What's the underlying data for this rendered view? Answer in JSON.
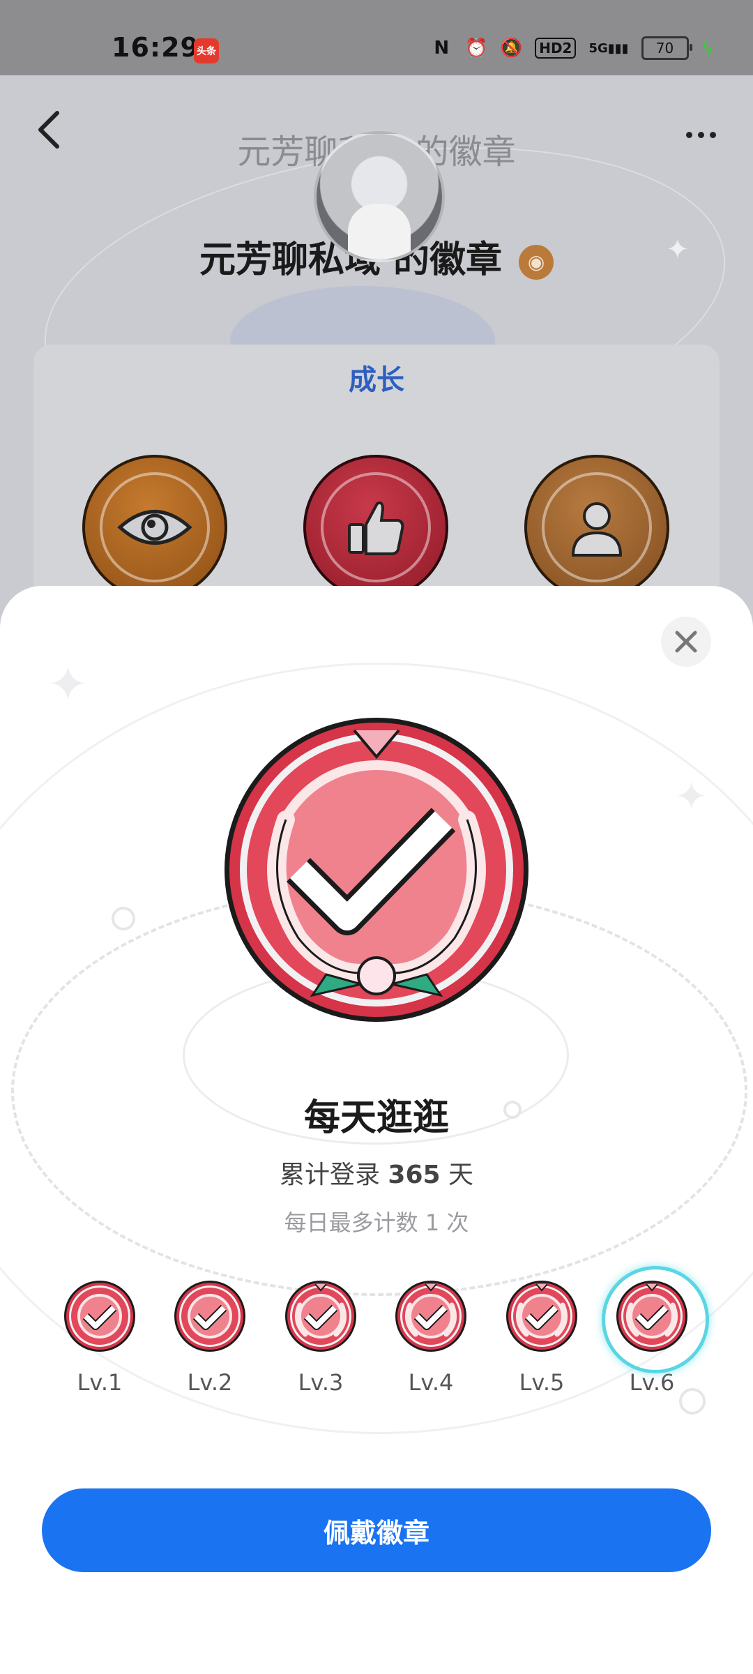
{
  "status_bar": {
    "time": "16:29",
    "app_badge": "头条",
    "network_label": "5G",
    "hd_label": "HD2",
    "battery": "70"
  },
  "nav": {
    "title": "元芳聊私域 的徽章",
    "back_icon": "chevron-left-icon",
    "more_icon": "more-horizontal-icon"
  },
  "profile": {
    "heading": "元芳聊私域 的徽章"
  },
  "growth_section": {
    "title": "成长",
    "badges": [
      "eye-badge",
      "thumbs-up-badge",
      "user-badge"
    ]
  },
  "sheet": {
    "badge_name": "每天逛逛",
    "desc_prefix": "累计登录 ",
    "desc_value": "365",
    "desc_suffix": " 天",
    "sub_text": "每日最多计数 1 次",
    "levels": [
      "Lv.1",
      "Lv.2",
      "Lv.3",
      "Lv.4",
      "Lv.5",
      "Lv.6"
    ],
    "selected_level": "Lv.6",
    "button_label": "佩戴徽章"
  },
  "colors": {
    "accent": "#1a73f0",
    "badge_red": "#e2475a",
    "selected_ring": "#58d6e4"
  }
}
